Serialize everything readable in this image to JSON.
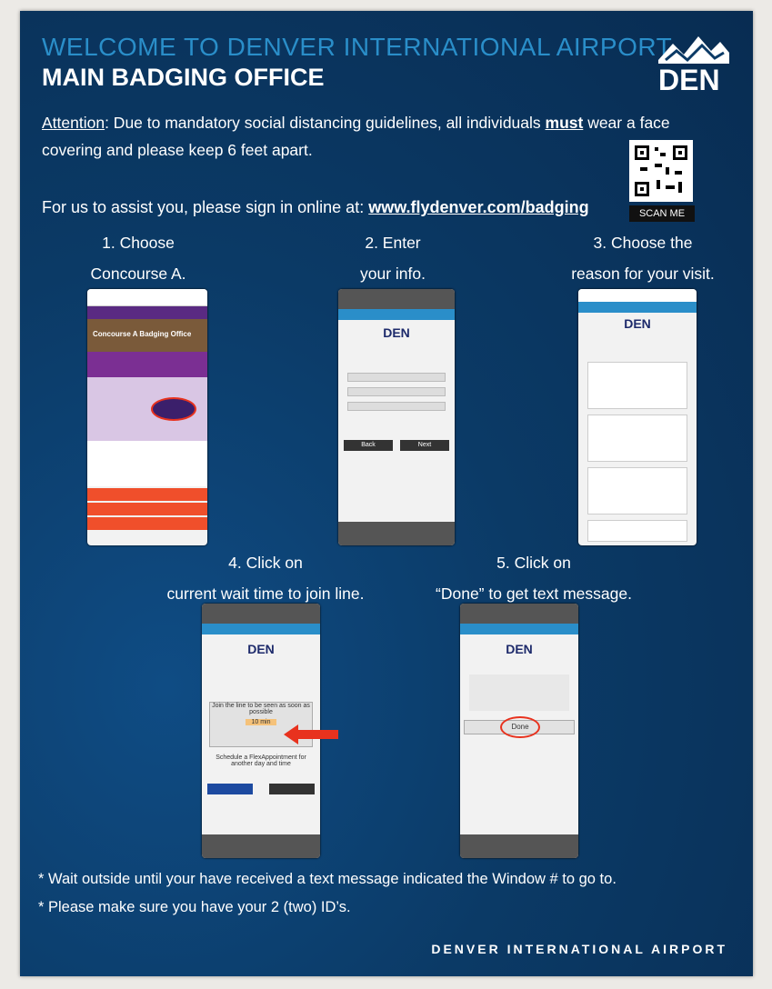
{
  "header": {
    "welcome": "WELCOME TO DENVER INTERNATIONAL AIRPORT",
    "office": "MAIN BADGING OFFICE",
    "logo_text": "DEN"
  },
  "attention": {
    "label": "Attention",
    "text_before": ": Due to mandatory social distancing guidelines, all individuals ",
    "emphasis": "must",
    "text_after": " wear a face covering and please keep 6 feet apart."
  },
  "signin": {
    "text": "For us to assist you, please sign in online at: ",
    "url": "www.flydenver.com/badging"
  },
  "qr": {
    "label": "SCAN ME"
  },
  "steps": [
    {
      "line1": "1. Choose",
      "line2": "Concourse A."
    },
    {
      "line1": "2. Enter",
      "line2": "your info."
    },
    {
      "line1": "3. Choose the",
      "line2": "reason for your visit."
    },
    {
      "line1": "4. Click on",
      "line2": "current wait time to join line."
    },
    {
      "line1": "5. Click on",
      "line2": "“Done” to get text message."
    }
  ],
  "screens": {
    "s1_title": "Concourse A Badging Office",
    "s2_back": "Back",
    "s2_next": "Next",
    "s4_join": "Join the line to be seen as soon as possible",
    "s4_wait": "10 min",
    "s4_schedule": "Schedule a FlexAppointment for another day and time",
    "s5_done": "Done"
  },
  "notes": [
    "* Wait outside until your have received a text message indicated the Window # to go to.",
    "* Please make sure you have your 2 (two) ID’s."
  ],
  "footer": "DENVER INTERNATIONAL AIRPORT",
  "colors": {
    "poster": "#0b3a66",
    "accent": "#2a8ec9",
    "arrow": "#e8321e"
  }
}
